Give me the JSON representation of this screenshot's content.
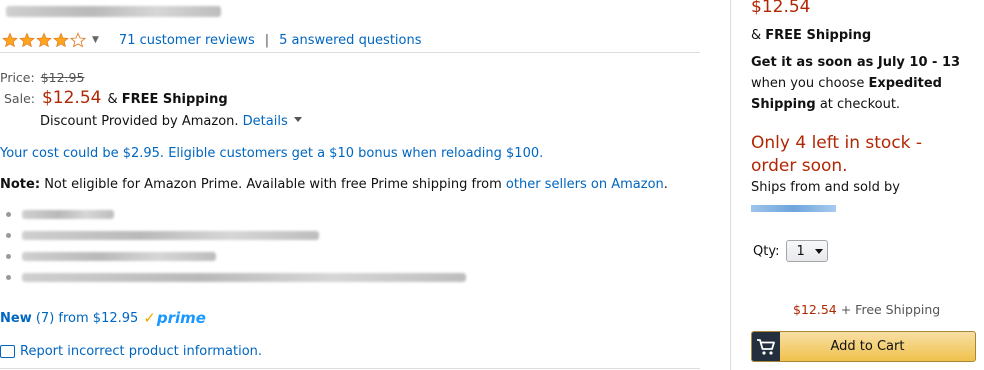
{
  "product": {
    "rating_stars": 4,
    "reviews_link": "71 customer reviews",
    "separator": "|",
    "questions_link": "5 answered questions"
  },
  "pricing": {
    "price_label": "Price:",
    "list_price": "$12.95",
    "sale_label": "Sale:",
    "sale_price": "$12.54",
    "shipping_prefix": "&",
    "shipping_text": "FREE Shipping",
    "discount_text": "Discount Provided by Amazon.",
    "details_link": "Details"
  },
  "promo": {
    "cost_text": "Your cost could be $2.95. Eligible customers get a $10 bonus when reloading $100."
  },
  "note": {
    "label": "Note:",
    "text": "Not eligible for Amazon Prime. Available with free Prime shipping from",
    "link": "other sellers on Amazon",
    "end": "."
  },
  "offers": {
    "new_label": "New",
    "count": "(7)",
    "from_text": "from $12.95",
    "prime_check": "✓",
    "prime_word": "prime"
  },
  "report": {
    "link": "Report incorrect product information."
  },
  "buybox": {
    "price": "$12.54",
    "shipping_prefix": "&",
    "shipping": "FREE Shipping",
    "get_it_prefix": "Get it as soon as July 10 - 13",
    "when_text": "when you choose",
    "expedited": "Expedited Shipping",
    "checkout_text": "at checkout.",
    "stock": "Only 4 left in stock - order soon.",
    "ships_from": "Ships from and sold by",
    "qty_label": "Qty:",
    "qty_value": "1",
    "offer_price": "$12.54",
    "offer_shipping": "+ Free Shipping",
    "cart_button": "Add to Cart"
  },
  "colors": {
    "link": "#0066c0",
    "price_red": "#b12704",
    "cart_yellow": "#f0c14b",
    "star": "#ffa41c"
  }
}
